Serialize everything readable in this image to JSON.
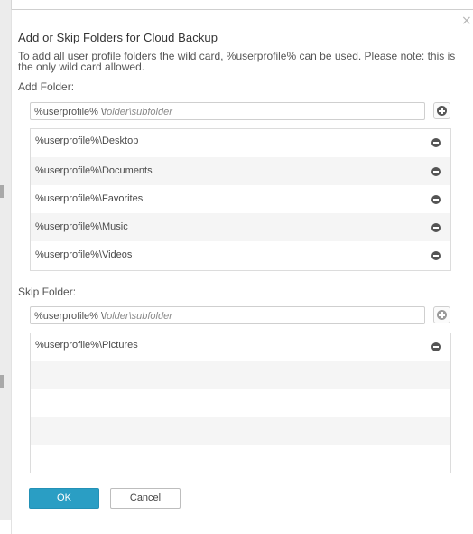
{
  "dialog": {
    "title": "Add or Skip Folders for Cloud Backup",
    "intro": "To add all user profile folders the wild card, %userprofile% can be used. Please note: this is the only wild card allowed.",
    "close_glyph": "×"
  },
  "add_section": {
    "label": "Add Folder:",
    "input_prefix": "%userprofile% \\",
    "input_hint": "folder\\subfolder",
    "items": [
      "%userprofile%\\Desktop",
      "%userprofile%\\Documents",
      "%userprofile%\\Favorites",
      "%userprofile%\\Music",
      "%userprofile%\\Videos"
    ]
  },
  "skip_section": {
    "label": "Skip Folder:",
    "input_prefix": "%userprofile% \\",
    "input_hint": "folder\\subfolder",
    "items": [
      "%userprofile%\\Pictures"
    ]
  },
  "buttons": {
    "ok": "OK",
    "cancel": "Cancel"
  },
  "colors": {
    "accent": "#2a9ec4"
  }
}
